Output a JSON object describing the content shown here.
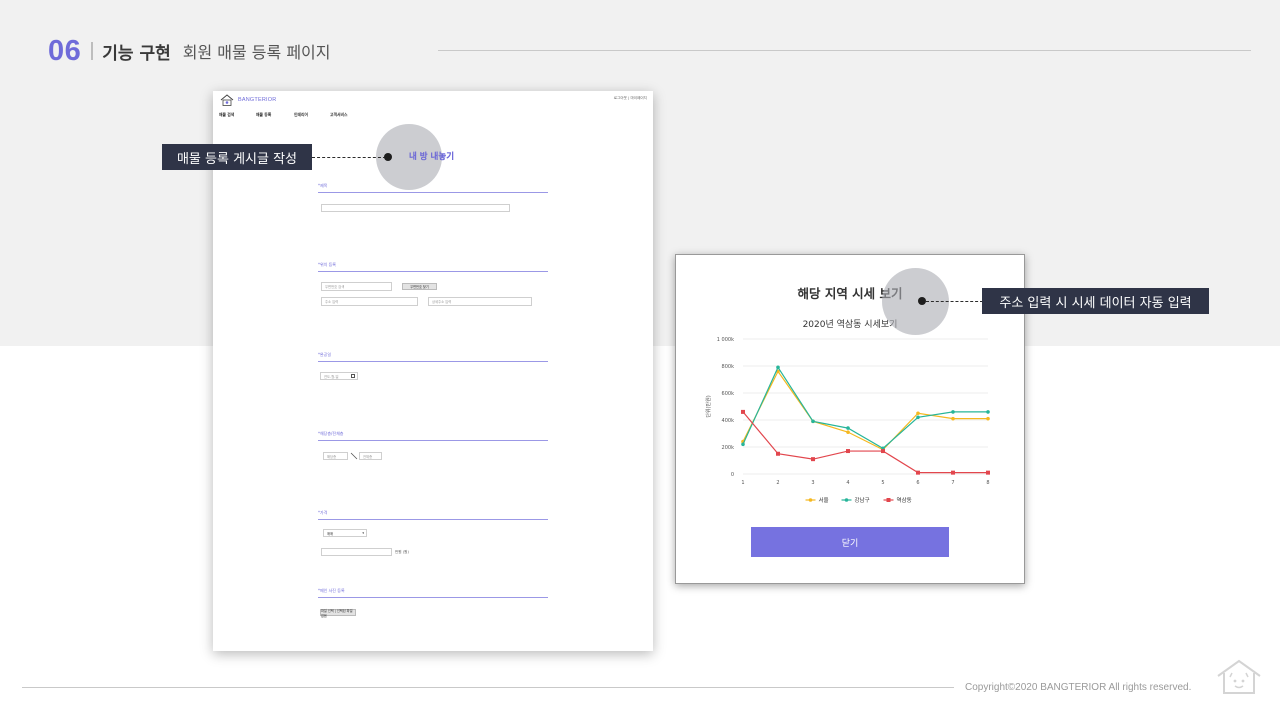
{
  "header": {
    "number": "06",
    "title": "기능 구현",
    "subtitle": "회원 매물 등록 페이지"
  },
  "left_screen": {
    "logo_text": "BANGTERIOR",
    "top_links": "로그아웃   |   마이페이지",
    "nav": [
      "매물 검색",
      "매물 등록",
      "인테리어",
      "고객서비스"
    ],
    "page_heading": "내 방 내놓기",
    "sections": {
      "title_label": "*제목",
      "location_label": "*위치 등록",
      "address_placeholder": "우편번호 검색",
      "address_button": "우편번호 찾기",
      "address_detail_placeholder": "주소 입력",
      "address_extra_placeholder": "상세주소 입력",
      "completion_label": "*완공일",
      "date_value": "연도-월-일",
      "area_label": "*해당층/전체층",
      "floor_placeholder": "해당층",
      "total_floor_placeholder": "전체층",
      "price_label": "*가격",
      "price_select": "매매",
      "price_unit": "만원 (원)",
      "photo_label": "*메인 사진 등록",
      "photo_button": "파일 선택 | 선택된 파일 없음"
    }
  },
  "callouts": {
    "left": "매물 등록 게시글 작성",
    "right": "주소 입력 시 시세 데이터 자동 입력"
  },
  "right_screen": {
    "modal_title": "해당 지역 시세 보기",
    "close_button": "닫기"
  },
  "chart_data": {
    "type": "line",
    "title": "2020년 역삼동 시세보기",
    "ylabel": "단위(만원)",
    "xlabel": "",
    "x": [
      1,
      2,
      3,
      4,
      5,
      6,
      7,
      8
    ],
    "ylim": [
      0,
      1000
    ],
    "yticks": [
      "0",
      "200k",
      "400k",
      "600k",
      "800k",
      "1 000k"
    ],
    "grid": true,
    "legend_position": "bottom",
    "series": [
      {
        "name": "서울",
        "color": "#f5b820",
        "marker": "circle",
        "values": [
          240,
          760,
          390,
          310,
          180,
          450,
          410,
          410
        ]
      },
      {
        "name": "강남구",
        "color": "#27b59a",
        "marker": "circle",
        "values": [
          220,
          790,
          390,
          340,
          190,
          420,
          460,
          460
        ]
      },
      {
        "name": "역삼동",
        "color": "#e2464d",
        "marker": "square",
        "values": [
          460,
          150,
          110,
          170,
          170,
          10,
          10,
          10
        ]
      }
    ]
  },
  "footer": {
    "copyright": "Copyright©2020 BANGTERIOR All rights reserved."
  }
}
